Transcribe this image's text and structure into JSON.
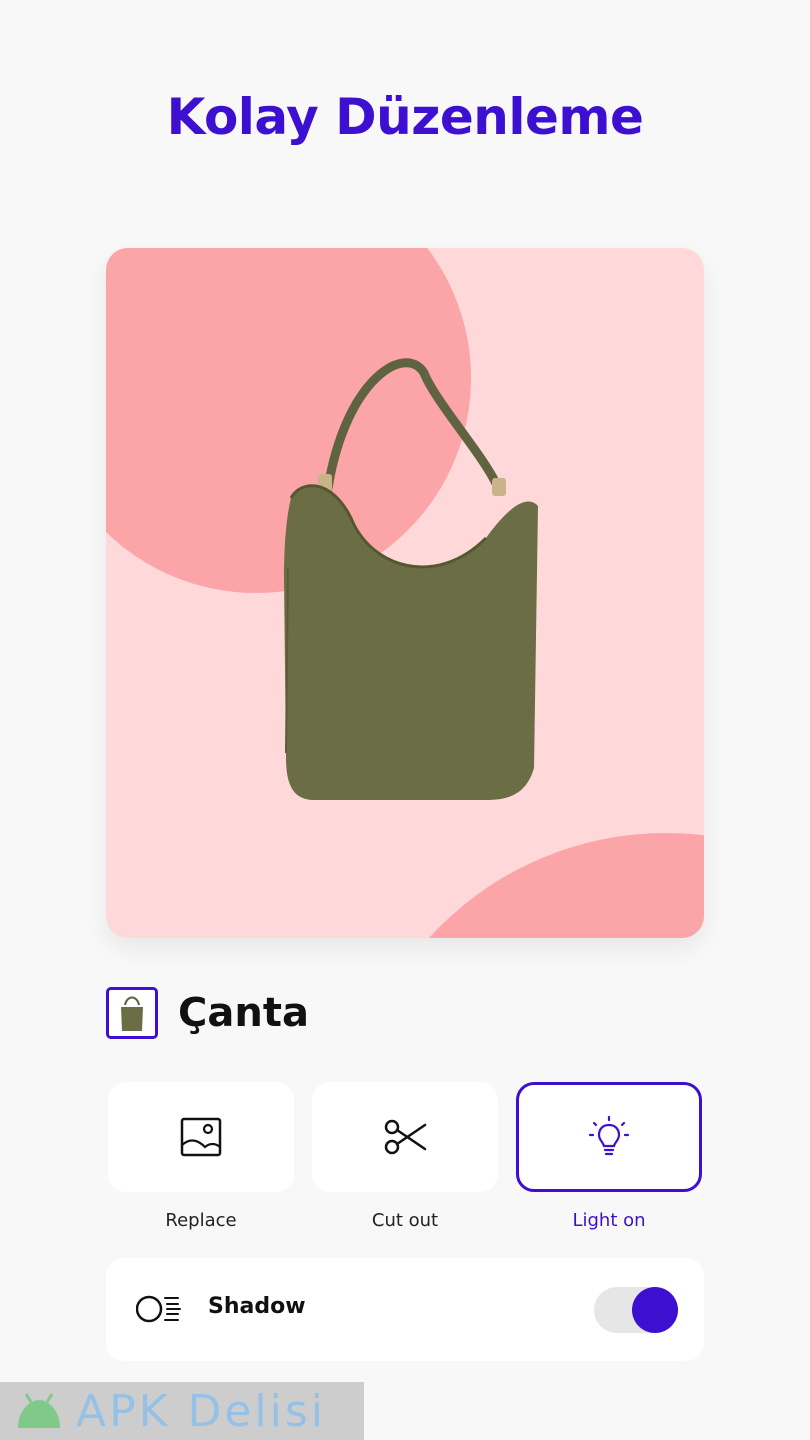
{
  "header": {
    "title": "Kolay Düzenleme"
  },
  "preview": {
    "background_color": "#ffd9da",
    "accent_shape_color": "#fca5a8",
    "product_color": "#6b6e45"
  },
  "product": {
    "name": "Çanta",
    "thumbnail_icon": "bag-thumbnail"
  },
  "tools": [
    {
      "label": "Replace",
      "icon": "replace-image-icon",
      "active": false
    },
    {
      "label": "Cut out",
      "icon": "scissors-icon",
      "active": false
    },
    {
      "label": "Light on",
      "icon": "lightbulb-icon",
      "active": true
    }
  ],
  "shadow": {
    "label": "Shadow",
    "enabled": true,
    "icon": "shadow-icon"
  },
  "watermark": {
    "text": "APK Delisi"
  },
  "colors": {
    "accent": "#3d0fd1"
  }
}
